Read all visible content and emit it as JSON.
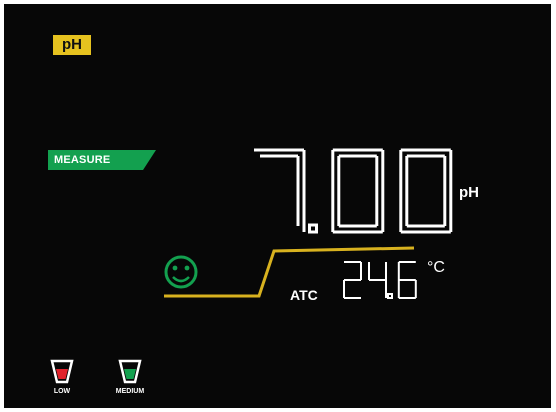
{
  "mode": "pH",
  "status": "MEASURE",
  "reading": {
    "value": "7.00",
    "unit": "pH"
  },
  "temperature": {
    "label": "ATC",
    "value": "24.6",
    "unit": "°C"
  },
  "indicator": {
    "icon": "smiley-icon",
    "color": "#13a04f"
  },
  "buffers": [
    {
      "label": "LOW",
      "color": "#e1222b"
    },
    {
      "label": "MEDIUM",
      "color": "#13a04f"
    }
  ],
  "colors": {
    "background": "#070707",
    "accent_yellow": "#e6c21f",
    "trend_line": "#d8b21f",
    "digits": "#ffffff"
  }
}
